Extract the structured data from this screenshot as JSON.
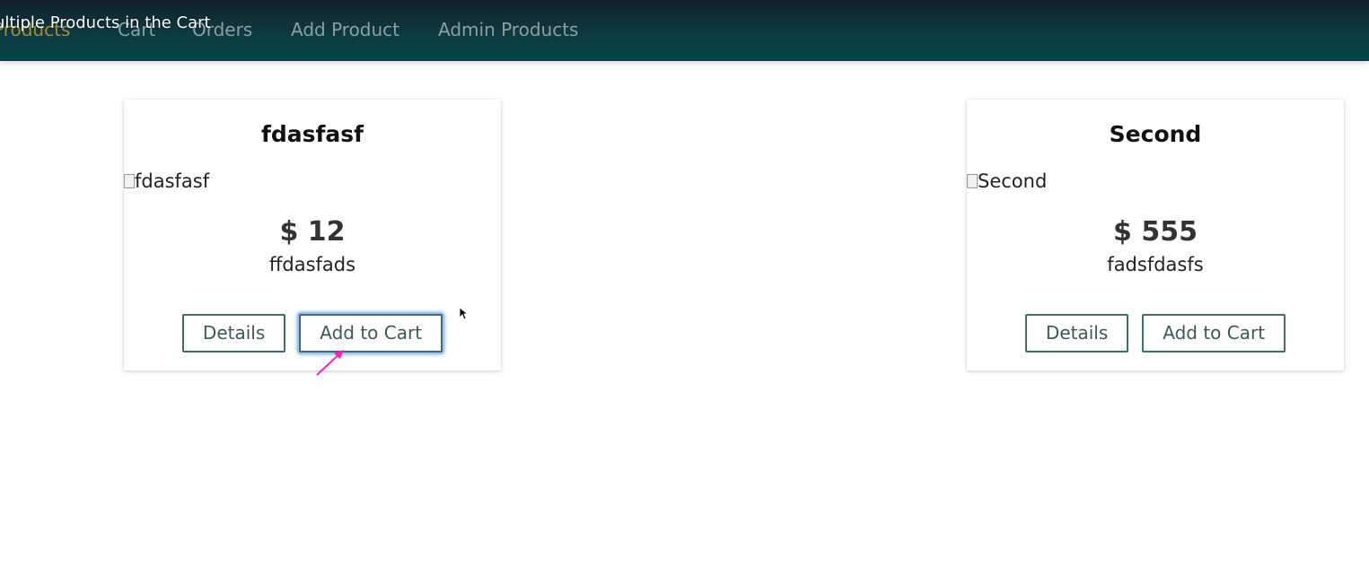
{
  "nav": {
    "items": [
      {
        "label": "Products",
        "active": true
      },
      {
        "label": "Cart",
        "active": false
      },
      {
        "label": "Orders",
        "active": false
      },
      {
        "label": "Add Product",
        "active": false
      },
      {
        "label": "Admin Products",
        "active": false
      }
    ],
    "overlay_title": "ultiple Products in the Cart"
  },
  "products": [
    {
      "title": "fdasfasf",
      "image_alt": "fdasfasf",
      "price": "$ 12",
      "description": "ffdasfads",
      "details_label": "Details",
      "add_label": "Add to Cart",
      "add_focused": true
    },
    {
      "title": "Second",
      "image_alt": "Second",
      "price": "$ 555",
      "description": "fadsfdasfs",
      "details_label": "Details",
      "add_label": "Add to Cart",
      "add_focused": false
    }
  ],
  "colors": {
    "nav_gradient_top": "#13202a",
    "nav_gradient_bottom": "#02484a",
    "nav_text": "#8e9ea2",
    "nav_active_text": "#a98a33",
    "button_border": "#3f6d6a",
    "focus_ring": "#6fa5ec",
    "annotation": "#ff1fc0"
  }
}
